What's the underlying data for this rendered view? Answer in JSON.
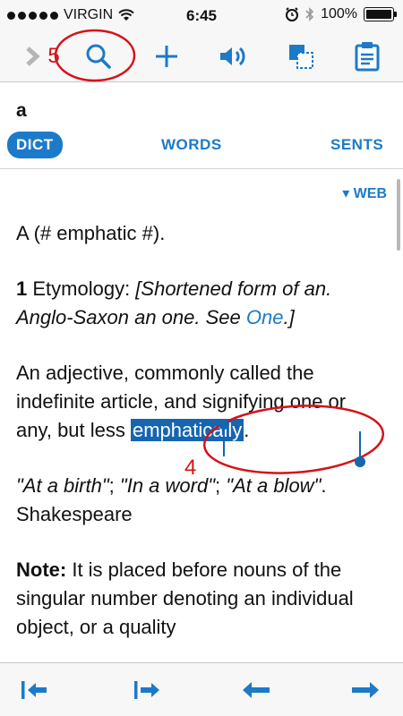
{
  "status_bar": {
    "carrier": "VIRGIN",
    "time": "6:45",
    "battery": "100%"
  },
  "toolbar": {
    "back_icon": "chevron-right-icon",
    "search_icon": "search-icon",
    "add_icon": "plus-icon",
    "speak_icon": "speaker-icon",
    "copy_icon": "copy-icon",
    "clipboard_icon": "clipboard-icon"
  },
  "annotations": {
    "label_5": "5",
    "label_4": "4",
    "color": "#d3131a"
  },
  "entry": {
    "headword": "a"
  },
  "tabs": [
    {
      "label": "DICT",
      "active": true
    },
    {
      "label": "WORDS",
      "active": false
    },
    {
      "label": "SENTS",
      "active": false
    }
  ],
  "web_link": "▾ WEB",
  "content": {
    "p1": "A (# emphatic #).",
    "p2_num": "1",
    "p2_label": " Etymology: ",
    "p2_italic_a": "[Shortened form of an. Anglo-Saxon an one. See ",
    "p2_link": "One",
    "p2_italic_b": ".]",
    "p3_a": "An adjective, commonly called the indefinite article, and signifying one or any, but less ",
    "p3_selected": "emphatically",
    "p3_b": ".",
    "p4_i1": "\"At a birth\"",
    "p4_s1": "; ",
    "p4_i2": "\"In a word\"",
    "p4_s2": "; ",
    "p4_i3": "\"At a blow\"",
    "p4_s3": ". Shakespeare",
    "p5_label": "Note:",
    "p5_text": " It is placed before nouns of the singular number denoting an individual object, or a quality"
  },
  "bottom_bar": {
    "first_icon": "skip-to-start-icon",
    "last_icon": "skip-to-end-icon",
    "prev_icon": "arrow-left-icon",
    "next_icon": "arrow-right-icon"
  },
  "colors": {
    "accent": "#1c7ac9",
    "selection": "#1565b0",
    "annotation": "#d3131a"
  }
}
